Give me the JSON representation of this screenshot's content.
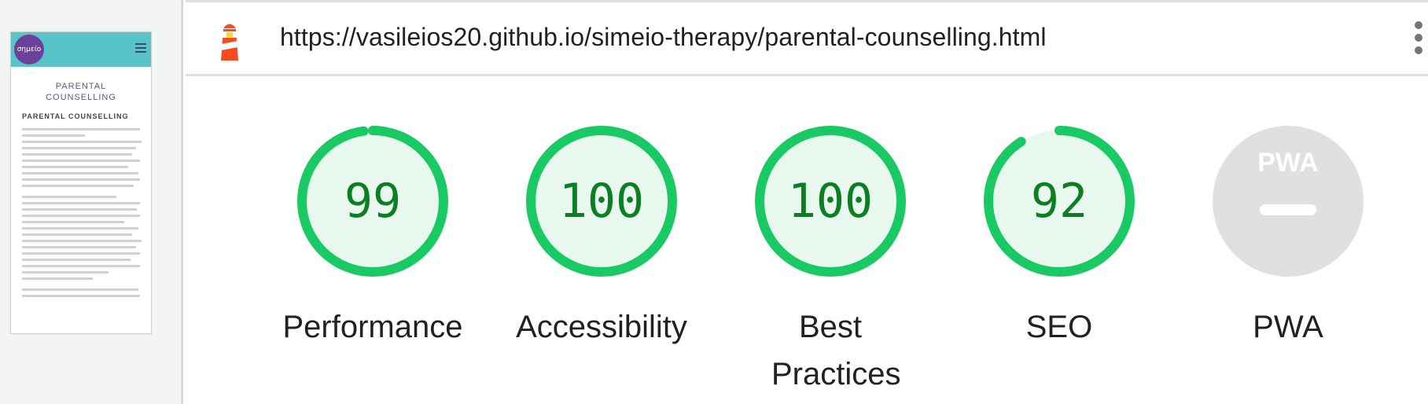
{
  "report": {
    "url": "https://vasileios20.github.io/simeio-therapy/parental-counselling.html"
  },
  "thumbnail": {
    "logo_text": "σημείο",
    "page_title_line1": "PARENTAL",
    "page_title_line2": "COUNSELLING",
    "section_heading": "PARENTAL COUNSELLING"
  },
  "categories": [
    {
      "label": "Performance",
      "score": "99",
      "value": 99
    },
    {
      "label": "Accessibility",
      "score": "100",
      "value": 100
    },
    {
      "label": "Best Practices",
      "score": "100",
      "value": 100
    },
    {
      "label": "SEO",
      "score": "92",
      "value": 92
    },
    {
      "label": "PWA",
      "score": "",
      "value": null,
      "badge": "PWA"
    }
  ],
  "colors": {
    "pass": "#18c964",
    "pass_fill": "#e8f8ef",
    "pass_text": "#0c7f22",
    "na": "#e0e0e0",
    "na_mark": "#ffffff"
  }
}
